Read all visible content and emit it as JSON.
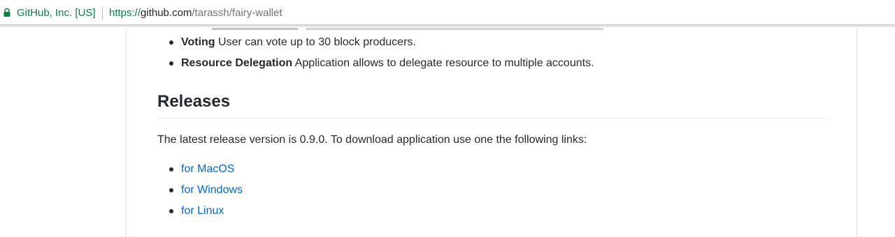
{
  "browser": {
    "site_identity": "GitHub, Inc. [US]",
    "url_scheme": "https://",
    "url_host": "github.com",
    "url_path": "/tarassh/fairy-wallet",
    "secure_color": "#0b8043"
  },
  "readme": {
    "features": [
      {
        "title": "Voting",
        "text": " User can vote up to 30 block producers."
      },
      {
        "title": "Resource Delegation",
        "text": " Application allows to delegate resource to multiple accounts."
      }
    ],
    "releases_heading": "Releases",
    "release_text": "The latest release version is 0.9.0. To download application use one the following links:",
    "links": [
      {
        "label": "for MacOS"
      },
      {
        "label": "for Windows"
      },
      {
        "label": "for Linux"
      }
    ],
    "link_color": "#0366d6"
  }
}
